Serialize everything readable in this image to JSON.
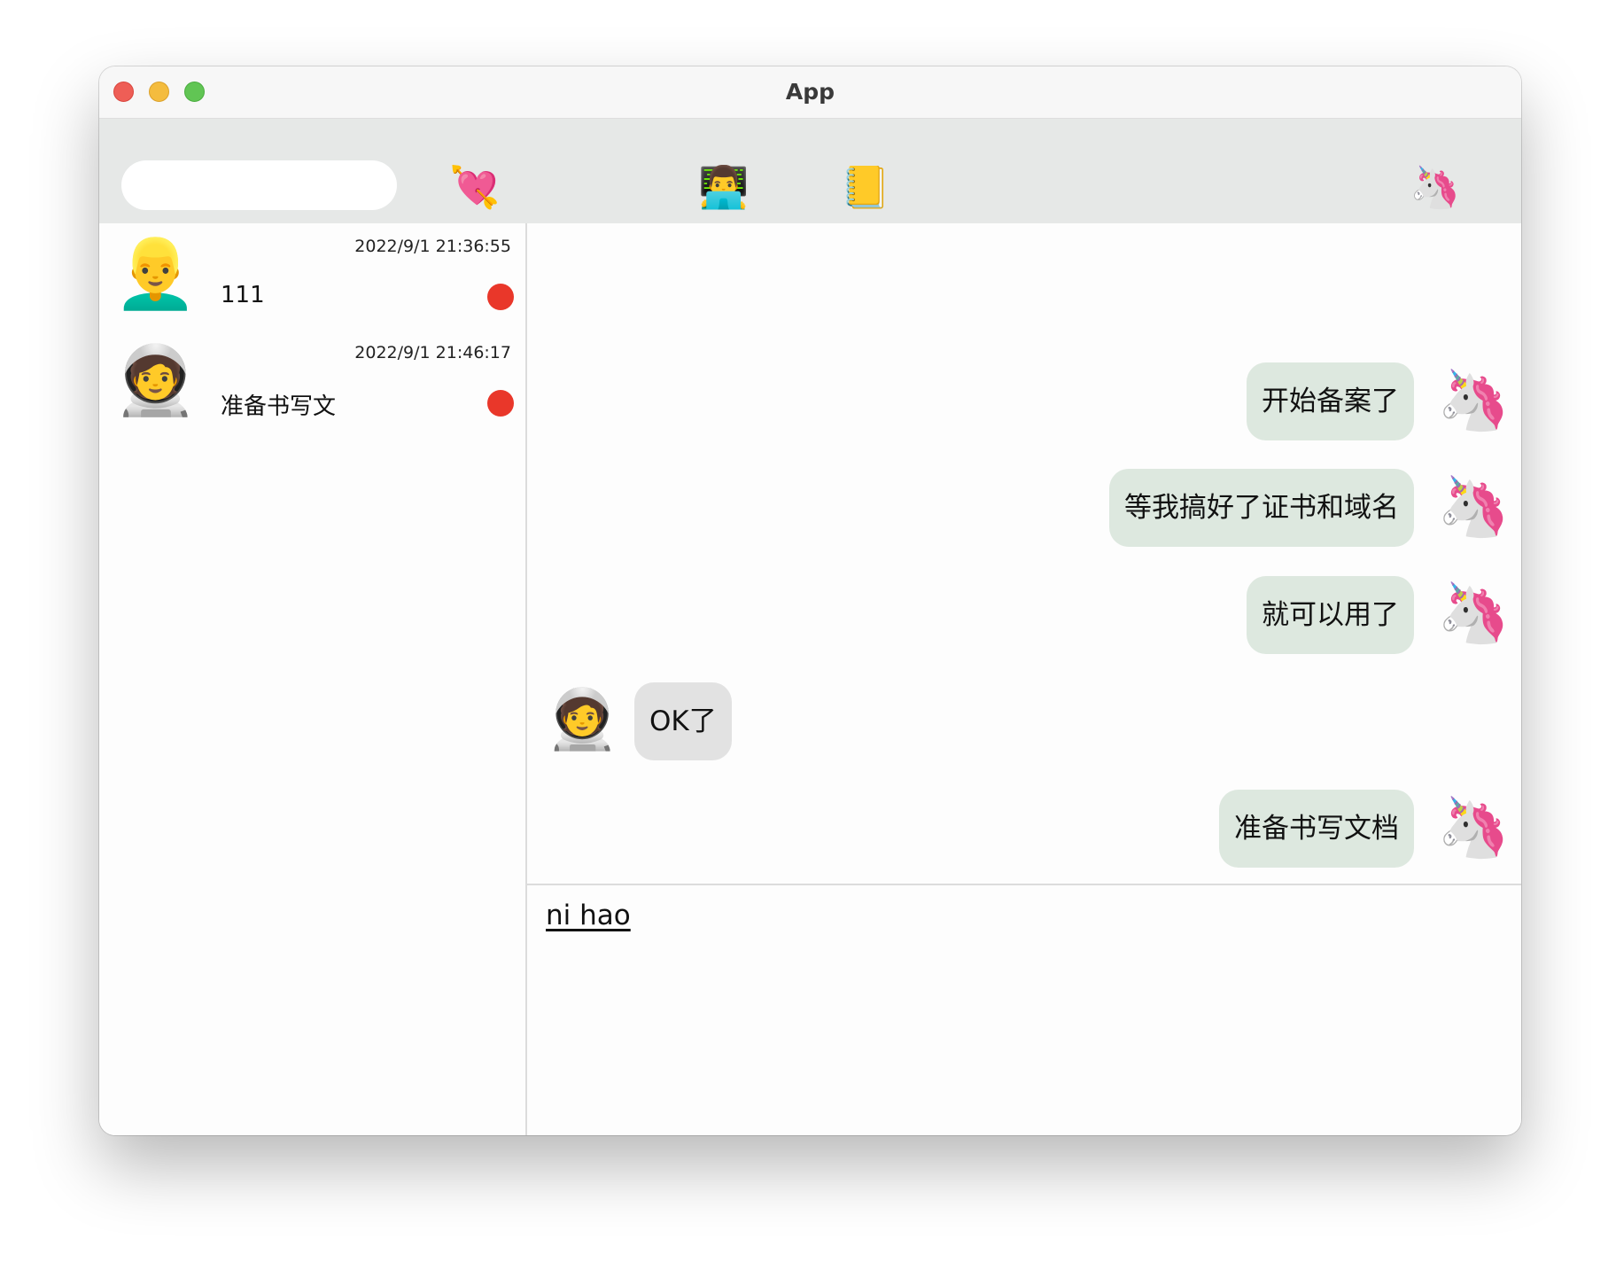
{
  "window": {
    "title": "App"
  },
  "toolbar": {
    "search": {
      "value": "",
      "placeholder": ""
    },
    "icons": {
      "heart": "💘",
      "developer": "👨‍💻",
      "notebook": "📒",
      "profile": "🦄"
    }
  },
  "conversations": [
    {
      "avatar": "👱‍♂️",
      "time": "2022/9/1 21:36:55",
      "preview": "111",
      "unread": true
    },
    {
      "avatar": "🧑‍🚀",
      "time": "2022/9/1 21:46:17",
      "preview": "准备书写文",
      "unread": true
    }
  ],
  "messages": [
    {
      "from": "me",
      "avatar": "🦄",
      "text": "开始备案了"
    },
    {
      "from": "me",
      "avatar": "🦄",
      "text": "等我搞好了证书和域名"
    },
    {
      "from": "me",
      "avatar": "🦄",
      "text": "就可以用了"
    },
    {
      "from": "other",
      "avatar": "🧑‍🚀",
      "text": "OK了"
    },
    {
      "from": "me",
      "avatar": "🦄",
      "text": "准备书写文档"
    }
  ],
  "composer": {
    "value": "ni hao"
  },
  "colors": {
    "sent_bubble": "#dde8df",
    "received_bubble": "#e2e2e2",
    "unread_dot": "#e9372a",
    "toolbar_bg": "#e6e8e7"
  }
}
